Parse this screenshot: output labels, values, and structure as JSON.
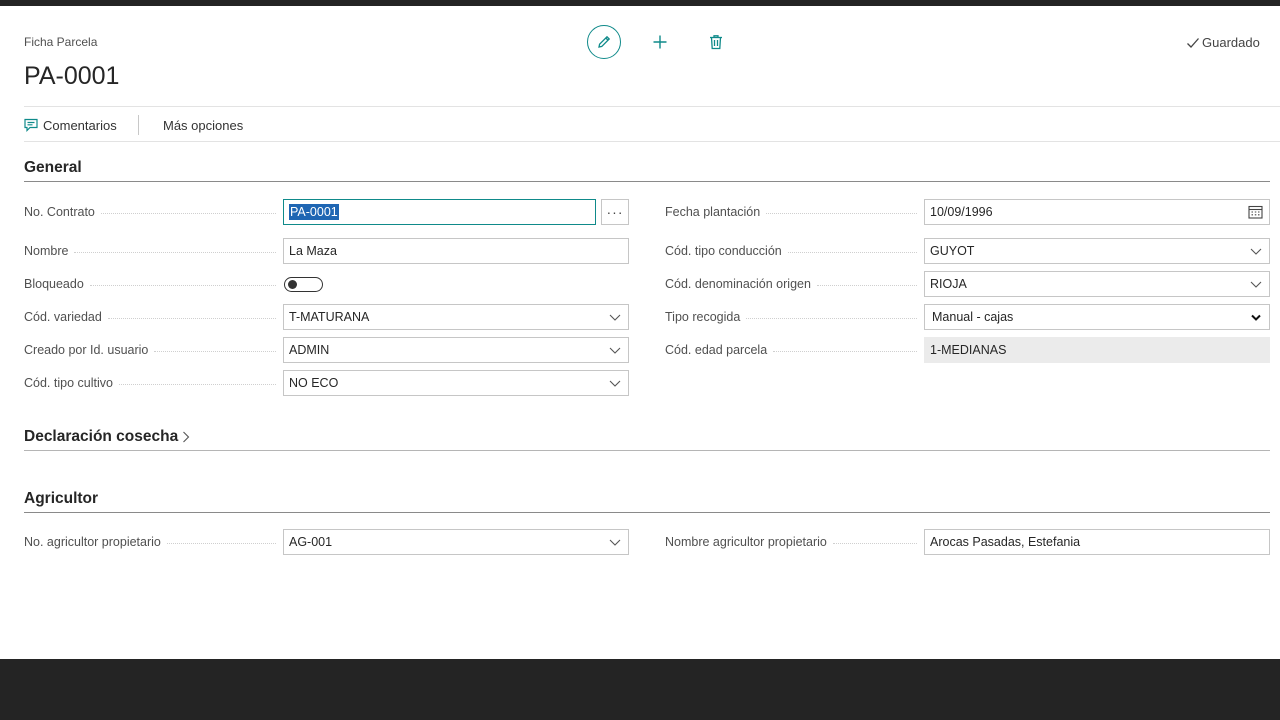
{
  "header": {
    "caption": "Ficha Parcela",
    "title": "PA-0001",
    "status": "Guardado"
  },
  "icons": {
    "edit": "pencil-icon",
    "new": "plus-icon",
    "delete": "trash-icon",
    "saved": "check-icon",
    "comments": "comment-icon"
  },
  "actionbar": {
    "comments": "Comentarios",
    "more": "Más opciones"
  },
  "sections": {
    "general": "General",
    "harvest": "Declaración cosecha",
    "farmer": "Agricultor"
  },
  "general": {
    "left": [
      {
        "label": "No. Contrato",
        "value": "PA-0001",
        "type": "text-lookup"
      },
      {
        "label": "Nombre",
        "value": "La Maza",
        "type": "text"
      },
      {
        "label": "Bloqueado",
        "value": "",
        "type": "toggle"
      },
      {
        "label": "Cód. variedad",
        "value": "T-MATURANA",
        "type": "dropdown"
      },
      {
        "label": "Creado por Id. usuario",
        "value": "ADMIN",
        "type": "dropdown"
      },
      {
        "label": "Cód. tipo cultivo",
        "value": "NO ECO",
        "type": "dropdown"
      }
    ],
    "right": [
      {
        "label": "Fecha plantación",
        "value": "10/09/1996",
        "type": "date"
      },
      {
        "label": "Cód. tipo conducción",
        "value": "GUYOT",
        "type": "dropdown"
      },
      {
        "label": "Cód. denominación origen",
        "value": "RIOJA",
        "type": "dropdown"
      },
      {
        "label": "Tipo recogida",
        "value": "Manual - cajas",
        "type": "select"
      },
      {
        "label": "Cód. edad parcela",
        "value": "1-MEDIANAS",
        "type": "readonly"
      }
    ]
  },
  "farmer": {
    "left": {
      "label": "No. agricultor propietario",
      "value": "AG-001"
    },
    "right": {
      "label": "Nombre agricultor propietario",
      "value": "Arocas Pasadas, Estefania"
    }
  },
  "colors": {
    "accent": "#0f8a8a",
    "selection": "#1f66b3",
    "frame": "#242424"
  }
}
